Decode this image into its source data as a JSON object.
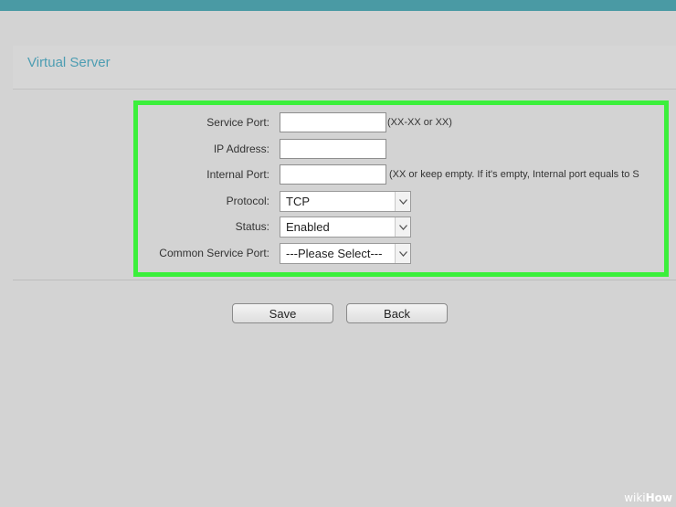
{
  "page": {
    "title": "Virtual Server"
  },
  "form": {
    "service_port": {
      "label": "Service Port:",
      "value": "",
      "hint": "(XX-XX or XX)"
    },
    "ip_address": {
      "label": "IP Address:",
      "value": ""
    },
    "internal_port": {
      "label": "Internal Port:",
      "value": "",
      "hint": "(XX or keep empty. If it's empty, Internal port equals to S"
    },
    "protocol": {
      "label": "Protocol:",
      "selected": "TCP"
    },
    "status": {
      "label": "Status:",
      "selected": "Enabled"
    },
    "common_service_port": {
      "label": "Common Service Port:",
      "selected": "---Please Select---"
    }
  },
  "buttons": {
    "save": "Save",
    "back": "Back"
  },
  "watermark": {
    "wiki": "wiki",
    "how": "How"
  },
  "colors": {
    "top_bar": "#4a9aa4",
    "title": "#4d9db2",
    "highlight": "#3bef3b",
    "background": "#d3d3d3"
  }
}
